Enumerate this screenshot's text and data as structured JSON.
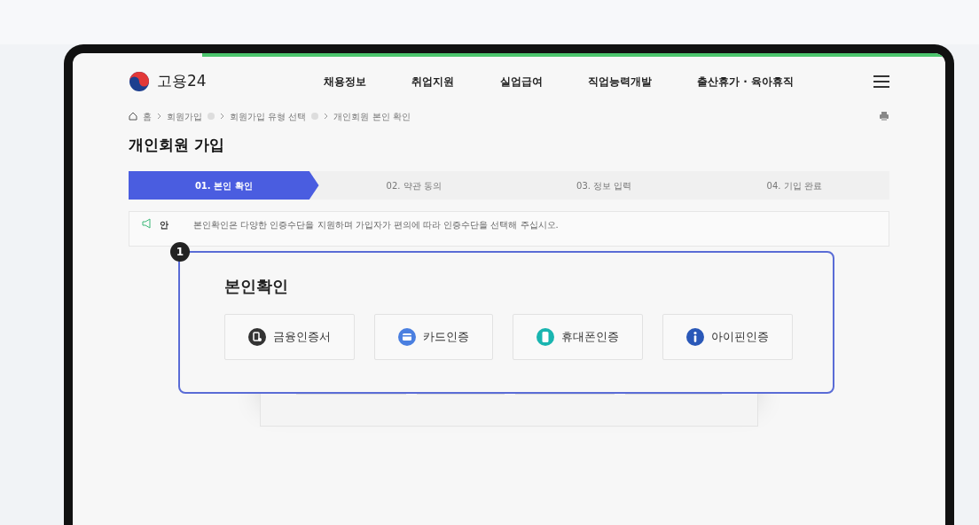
{
  "header": {
    "logo_text": "고용24",
    "nav": [
      "채용정보",
      "취업지원",
      "실업급여",
      "직업능력개발",
      "출산휴가 · 육아휴직"
    ]
  },
  "breadcrumb": [
    "홈",
    "회원가입",
    "회원가입 유형 선택",
    "개인회원 본인 확인"
  ],
  "page_title": "개인회원 가입",
  "steps": [
    {
      "label": "01. 본인 확인",
      "selected": true
    },
    {
      "label": "02. 약관 동의",
      "selected": false
    },
    {
      "label": "03. 정보 입력",
      "selected": false
    },
    {
      "label": "04. 기입 완료",
      "selected": false
    }
  ],
  "notice": {
    "label": "안",
    "text": "본인확인은 다양한 인증수단을 지원하며 가입자가 편의에 따라 인증수단을 선택해 주십시오."
  },
  "callout": {
    "number": "1",
    "title": "본인확인",
    "methods": [
      {
        "kind": "certificate",
        "label": "금융인증서"
      },
      {
        "kind": "card",
        "label": "카드인증"
      },
      {
        "kind": "phone",
        "label": "휴대폰인증"
      },
      {
        "kind": "ipin",
        "label": "아이핀인증"
      }
    ]
  }
}
